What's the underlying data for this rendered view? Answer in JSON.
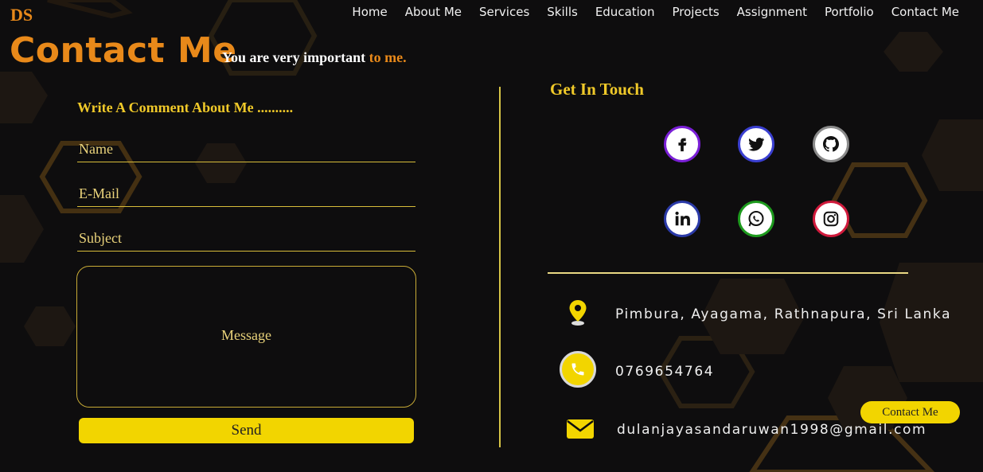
{
  "brand": {
    "logo": "DS"
  },
  "nav": {
    "items": [
      "Home",
      "About Me",
      "Services",
      "Skills",
      "Education",
      "Projects",
      "Assignment",
      "Portfolio",
      "Contact Me"
    ]
  },
  "hero": {
    "title": "Contact Me",
    "subtitle_main": "You are very important",
    "subtitle_accent": "to me."
  },
  "form": {
    "heading": "Write A Comment About Me ..........",
    "name_placeholder": "Name",
    "email_placeholder": "E-Mail",
    "subject_placeholder": "Subject",
    "message_placeholder": "Message",
    "send_label": "Send"
  },
  "contact": {
    "heading": "Get In Touch",
    "socials": [
      {
        "name": "facebook-icon",
        "ring_color": "#7a1fd6"
      },
      {
        "name": "twitter-icon",
        "ring_color": "#3a3fd0"
      },
      {
        "name": "github-icon",
        "ring_color": "#8a8a8a"
      },
      {
        "name": "linkedin-icon",
        "ring_color": "#2b3aa8"
      },
      {
        "name": "whatsapp-icon",
        "ring_color": "#1d9a1d"
      },
      {
        "name": "instagram-icon",
        "ring_color": "#d01a3c"
      }
    ],
    "address": "Pimbura, Ayagama, Rathnapura, Sri Lanka",
    "phone": "0769654764",
    "email": "dulanjayasandaruwan1998@gmail.com"
  },
  "floating_button": {
    "label": "Contact Me"
  },
  "colors": {
    "accent_orange": "#e8891a",
    "accent_yellow": "#f2d500",
    "background": "#0e0d0e"
  }
}
